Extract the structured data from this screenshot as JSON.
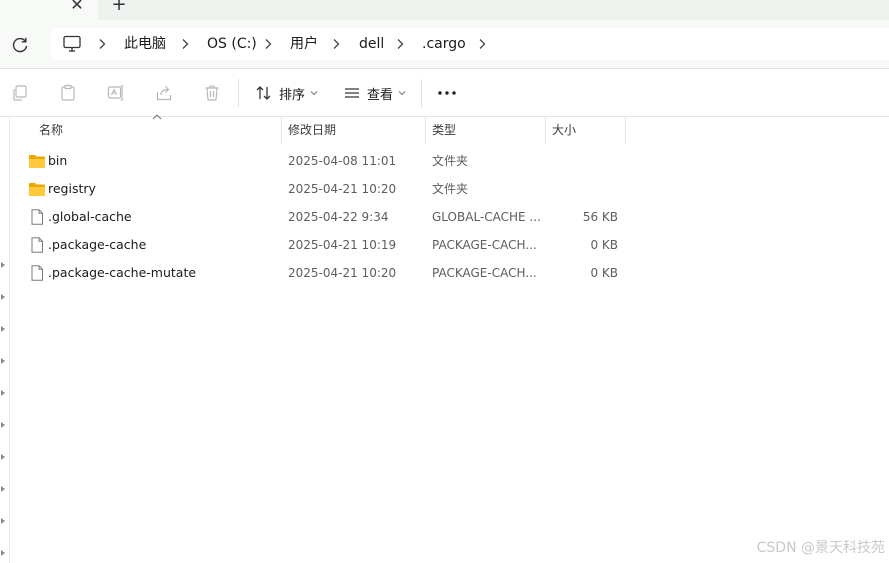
{
  "tabbar": {
    "close_glyph": "✕",
    "new_tab_glyph": "+"
  },
  "address_bar": {
    "refresh_icon": "refresh-icon",
    "pc_icon": "this-pc-icon",
    "breadcrumbs": [
      "此电脑",
      "OS (C:)",
      "用户",
      "dell",
      ".cargo"
    ]
  },
  "toolbar": {
    "icons": [
      "copy-icon",
      "paste-icon",
      "rename-icon",
      "share-icon",
      "delete-icon"
    ],
    "sort_label": "排序",
    "view_label": "查看",
    "more_glyph": "···"
  },
  "columns": {
    "name": "名称",
    "date": "修改日期",
    "type": "类型",
    "size": "大小"
  },
  "files": [
    {
      "kind": "folder",
      "name": "bin",
      "date": "2025-04-08 11:01",
      "type": "文件夹",
      "size": ""
    },
    {
      "kind": "folder",
      "name": "registry",
      "date": "2025-04-21 10:20",
      "type": "文件夹",
      "size": ""
    },
    {
      "kind": "file",
      "name": ".global-cache",
      "date": "2025-04-22 9:34",
      "type": "GLOBAL-CACHE ...",
      "size": "56 KB"
    },
    {
      "kind": "file",
      "name": ".package-cache",
      "date": "2025-04-21 10:19",
      "type": "PACKAGE-CACH...",
      "size": "0 KB"
    },
    {
      "kind": "file",
      "name": ".package-cache-mutate",
      "date": "2025-04-21 10:20",
      "type": "PACKAGE-CACH...",
      "size": "0 KB"
    }
  ],
  "colors": {
    "folder": "#f2b600",
    "accent": "#0067c0"
  },
  "watermark": "CSDN @景天科技苑"
}
